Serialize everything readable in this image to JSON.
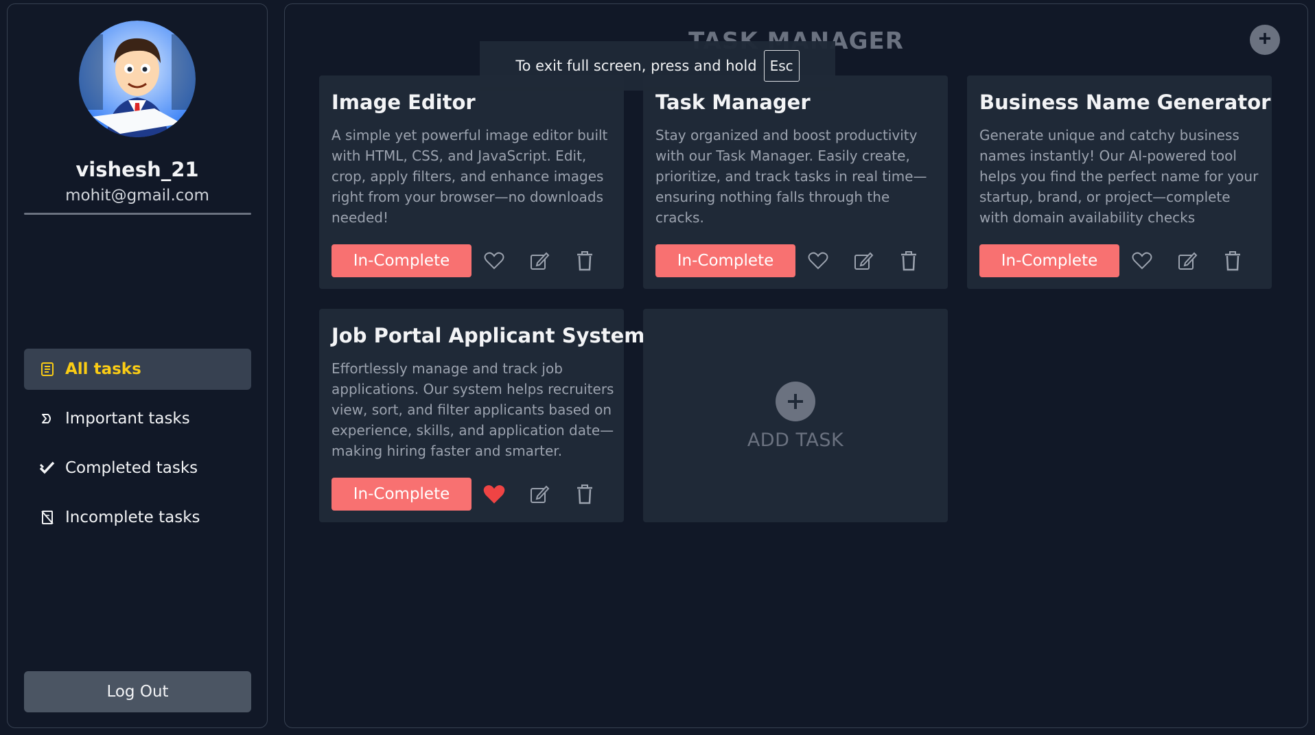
{
  "user": {
    "username": "vishesh_21",
    "email": "mohit@gmail.com"
  },
  "sidebar": {
    "items": [
      {
        "label": "All tasks",
        "icon": "list-icon",
        "active": true
      },
      {
        "label": "Important tasks",
        "icon": "tag-icon",
        "active": false
      },
      {
        "label": "Completed tasks",
        "icon": "double-check-icon",
        "active": false
      },
      {
        "label": "Incomplete tasks",
        "icon": "slashed-note-icon",
        "active": false
      }
    ],
    "logout_label": "Log Out"
  },
  "main": {
    "title": "TASK MANAGER",
    "fullscreen_notice": "To exit full screen, press and hold",
    "fullscreen_key": "Esc",
    "add_task_label": "ADD TASK"
  },
  "tasks": [
    {
      "title": "Image Editor",
      "description": "A simple yet powerful image editor built with HTML, CSS, and JavaScript. Edit, crop, apply filters, and enhance images right from your browser—no downloads needed!",
      "status": "In-Complete",
      "important": false
    },
    {
      "title": "Task Manager",
      "description": "Stay organized and boost productivity with our Task Manager. Easily create, prioritize, and track tasks in real time—ensuring nothing falls through the cracks.",
      "status": "In-Complete",
      "important": false
    },
    {
      "title": "Business Name Generator",
      "description": "Generate unique and catchy business names instantly! Our AI-powered tool helps you find the perfect name for your startup, brand, or project—complete with domain availability checks",
      "status": "In-Complete",
      "important": false
    },
    {
      "title": "Job Portal Applicant System",
      "description": "Effortlessly manage and track job applications. Our system helps recruiters view, sort, and filter applicants based on experience, skills, and application date—making hiring faster and smarter.",
      "status": "In-Complete",
      "important": true
    }
  ],
  "colors": {
    "background": "#111827",
    "card": "#1f2937",
    "accent_active": "#facc15",
    "status_button": "#f87171",
    "heart_active": "#ef4444",
    "muted": "#6b7280"
  }
}
